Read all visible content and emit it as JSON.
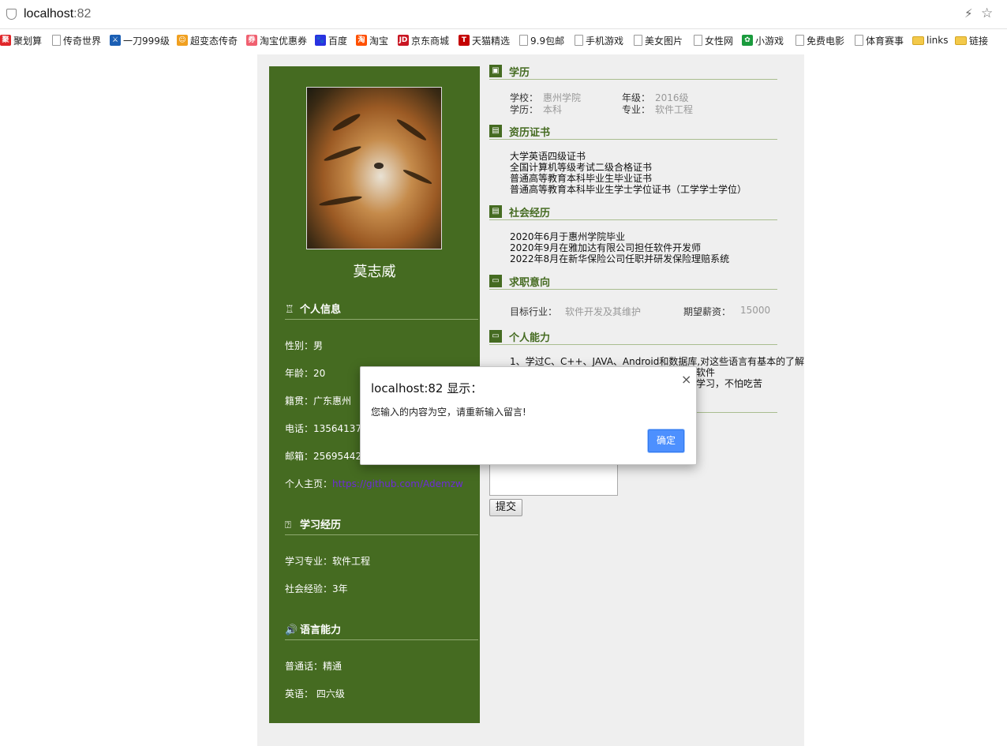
{
  "browser": {
    "host": "localhost",
    "port": ":82",
    "bookmarks": [
      {
        "label": "聚划算",
        "icon": "juhuasuan-icon",
        "color": "#e0262a",
        "glyph": "聚"
      },
      {
        "label": "传奇世界",
        "icon": "page-icon"
      },
      {
        "label": "一刀999级",
        "icon": "game-icon",
        "color": "#1b5fb4",
        "glyph": "⚔"
      },
      {
        "label": "超变态传奇",
        "icon": "game-icon",
        "color": "#f0a020",
        "glyph": "☺"
      },
      {
        "label": "淘宝优惠券",
        "icon": "taobao-icon",
        "color": "#f06070",
        "glyph": "券"
      },
      {
        "label": "百度",
        "icon": "baidu-icon",
        "color": "#2932e1",
        "glyph": "🐾"
      },
      {
        "label": "淘宝",
        "icon": "taobao-icon",
        "color": "#ff5000",
        "glyph": "淘"
      },
      {
        "label": "京东商城",
        "icon": "jd-icon",
        "color": "#c91623",
        "glyph": "JD"
      },
      {
        "label": "天猫精选",
        "icon": "tmall-icon",
        "color": "#c40000",
        "glyph": "T"
      },
      {
        "label": "9.9包邮",
        "icon": "page-icon"
      },
      {
        "label": "手机游戏",
        "icon": "page-icon"
      },
      {
        "label": "美女图片",
        "icon": "page-icon"
      },
      {
        "label": "女性网",
        "icon": "page-icon"
      },
      {
        "label": "小游戏",
        "icon": "game-icon",
        "color": "#1a9b3d",
        "glyph": "✿"
      },
      {
        "label": "免费电影",
        "icon": "page-icon"
      },
      {
        "label": "体育赛事",
        "icon": "page-icon"
      },
      {
        "label": "links",
        "icon": "folder-icon"
      },
      {
        "label": "链接",
        "icon": "folder-icon"
      }
    ]
  },
  "left": {
    "name": "莫志威",
    "personal": {
      "title": "个人信息",
      "gender": "性别：男",
      "age": "年龄：20",
      "origin": "籍贯：广东惠州",
      "phone": "电话：13564137",
      "email": "邮箱：25695442",
      "homepage_label": "个人主页：",
      "homepage_link": "https://github.com/Ademzw"
    },
    "study": {
      "title": "学习经历",
      "major": "学习专业：软件工程",
      "experience": "社会经验：3年"
    },
    "language": {
      "title": "语言能力",
      "mandarin": "普通话：精通",
      "english": "英语：  四六级"
    }
  },
  "right": {
    "education": {
      "title": "学历",
      "school_label": "学校：",
      "school": "惠州学院",
      "grade_label": "年级：",
      "grade": "2016级",
      "degree_label": "学历：",
      "degree": "本科",
      "major_label": "专业：",
      "major": "软件工程"
    },
    "certificates": {
      "title": "资历证书",
      "items": [
        "大学英语四级证书",
        "全国计算机等级考试二级合格证书",
        "普通高等教育本科毕业生毕业证书",
        "普通高等教育本科毕业生学士学位证书（工学学士学位）"
      ]
    },
    "social": {
      "title": "社会经历",
      "items": [
        "2020年6月于惠州学院毕业",
        "2020年9月在雅加达有限公司担任软件开发师",
        "2022年8月在新华保险公司任职并研发保险理赔系统"
      ]
    },
    "intent": {
      "title": "求职意向",
      "industry_label": "目标行业：",
      "industry": "软件开发及其维护",
      "salary_label": "期望薪资：",
      "salary": "15000"
    },
    "ability": {
      "title": "个人能力",
      "line1": "1、学过C、C++、JAVA、Android和数据库,对这些语言有基本的了解",
      "line2_tail": "诡软件",
      "line3_tail": "于学习，不怕吃苦"
    },
    "submit_label": "提交"
  },
  "dialog": {
    "title": "localhost:82 显示：",
    "message": "您输入的内容为空，请重新输入留言!",
    "ok_label": "确定",
    "close_glyph": "×"
  }
}
